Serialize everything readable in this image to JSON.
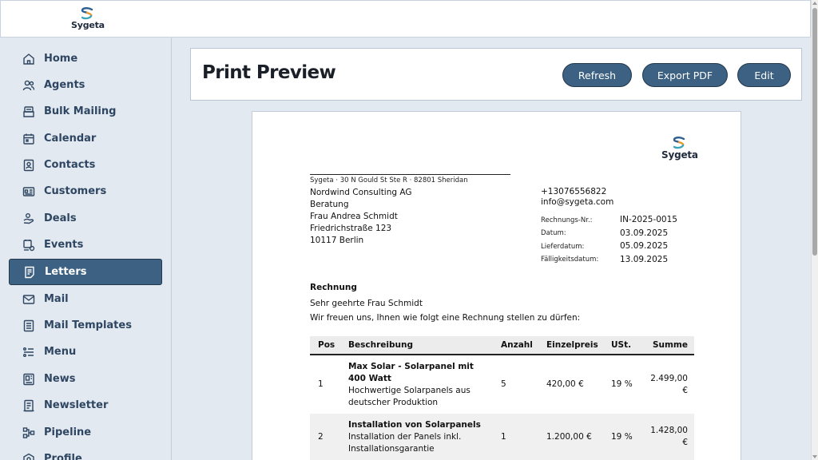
{
  "brand": {
    "name": "Sygeta",
    "colors": {
      "accent": "#3d6182",
      "logo_blue": "#2f5f8f",
      "logo_orange": "#e79a2c",
      "logo_teal": "#3aa6b9"
    }
  },
  "sidebar": {
    "items": [
      {
        "label": "Home",
        "icon": "home-icon"
      },
      {
        "label": "Agents",
        "icon": "users-icon"
      },
      {
        "label": "Bulk Mailing",
        "icon": "mail-stack-icon"
      },
      {
        "label": "Calendar",
        "icon": "calendar-icon"
      },
      {
        "label": "Contacts",
        "icon": "contact-card-icon"
      },
      {
        "label": "Customers",
        "icon": "id-card-icon"
      },
      {
        "label": "Deals",
        "icon": "handshake-icon"
      },
      {
        "label": "Events",
        "icon": "event-icon"
      },
      {
        "label": "Letters",
        "icon": "letter-icon",
        "active": true
      },
      {
        "label": "Mail",
        "icon": "envelope-icon"
      },
      {
        "label": "Mail Templates",
        "icon": "template-icon"
      },
      {
        "label": "Menu",
        "icon": "menu-icon"
      },
      {
        "label": "News",
        "icon": "news-icon"
      },
      {
        "label": "Newsletter",
        "icon": "newsletter-icon"
      },
      {
        "label": "Pipeline",
        "icon": "pipeline-icon"
      },
      {
        "label": "Profile",
        "icon": "profile-icon"
      }
    ]
  },
  "header": {
    "title": "Print Preview",
    "buttons": {
      "refresh": "Refresh",
      "export": "Export PDF",
      "edit": "Edit"
    }
  },
  "document": {
    "logo_text": "Sygeta",
    "sender_line": "Sygeta  ·  30 N Gould St Ste R  · 82801 Sheridan",
    "recipient": [
      "Nordwind Consulting AG",
      "Beratung",
      "Frau Andrea Schmidt",
      "Friedrichstraße 123",
      "10117 Berlin"
    ],
    "phone": "+13076556822",
    "email": "info@sygeta.com",
    "meta": [
      {
        "label": "Rechnungs-Nr.:",
        "value": "IN-2025-0015"
      },
      {
        "label": "Datum:",
        "value": "03.09.2025"
      },
      {
        "label": "Lieferdatum:",
        "value": "05.09.2025"
      },
      {
        "label": "Fälligkeitsdatum:",
        "value": "13.09.2025"
      }
    ],
    "heading": "Rechnung",
    "salutation": "Sehr geehrte Frau Schmidt",
    "intro": "Wir freuen uns, Ihnen wie folgt eine Rechnung stellen zu dürfen:",
    "table": {
      "headers": {
        "pos": "Pos",
        "desc": "Beschreibung",
        "qty": "Anzahl",
        "unit": "Einzelpreis",
        "tax": "USt.",
        "sum": "Summe"
      },
      "rows": [
        {
          "pos": "1",
          "title": "Max Solar - Solarpanel mit 400 Watt",
          "text": "Hochwertige Solarpanels aus deutscher Produktion",
          "qty": "5",
          "unit": "420,00 €",
          "tax": "19 %",
          "sum": "2.499,00 €"
        },
        {
          "pos": "2",
          "title": "Installation von Solarpanels",
          "text": "Installation der Panels inkl. Installationsgarantie",
          "qty": "1",
          "unit": "1.200,00 €",
          "tax": "19 %",
          "sum": "1.428,00 €"
        }
      ]
    }
  }
}
